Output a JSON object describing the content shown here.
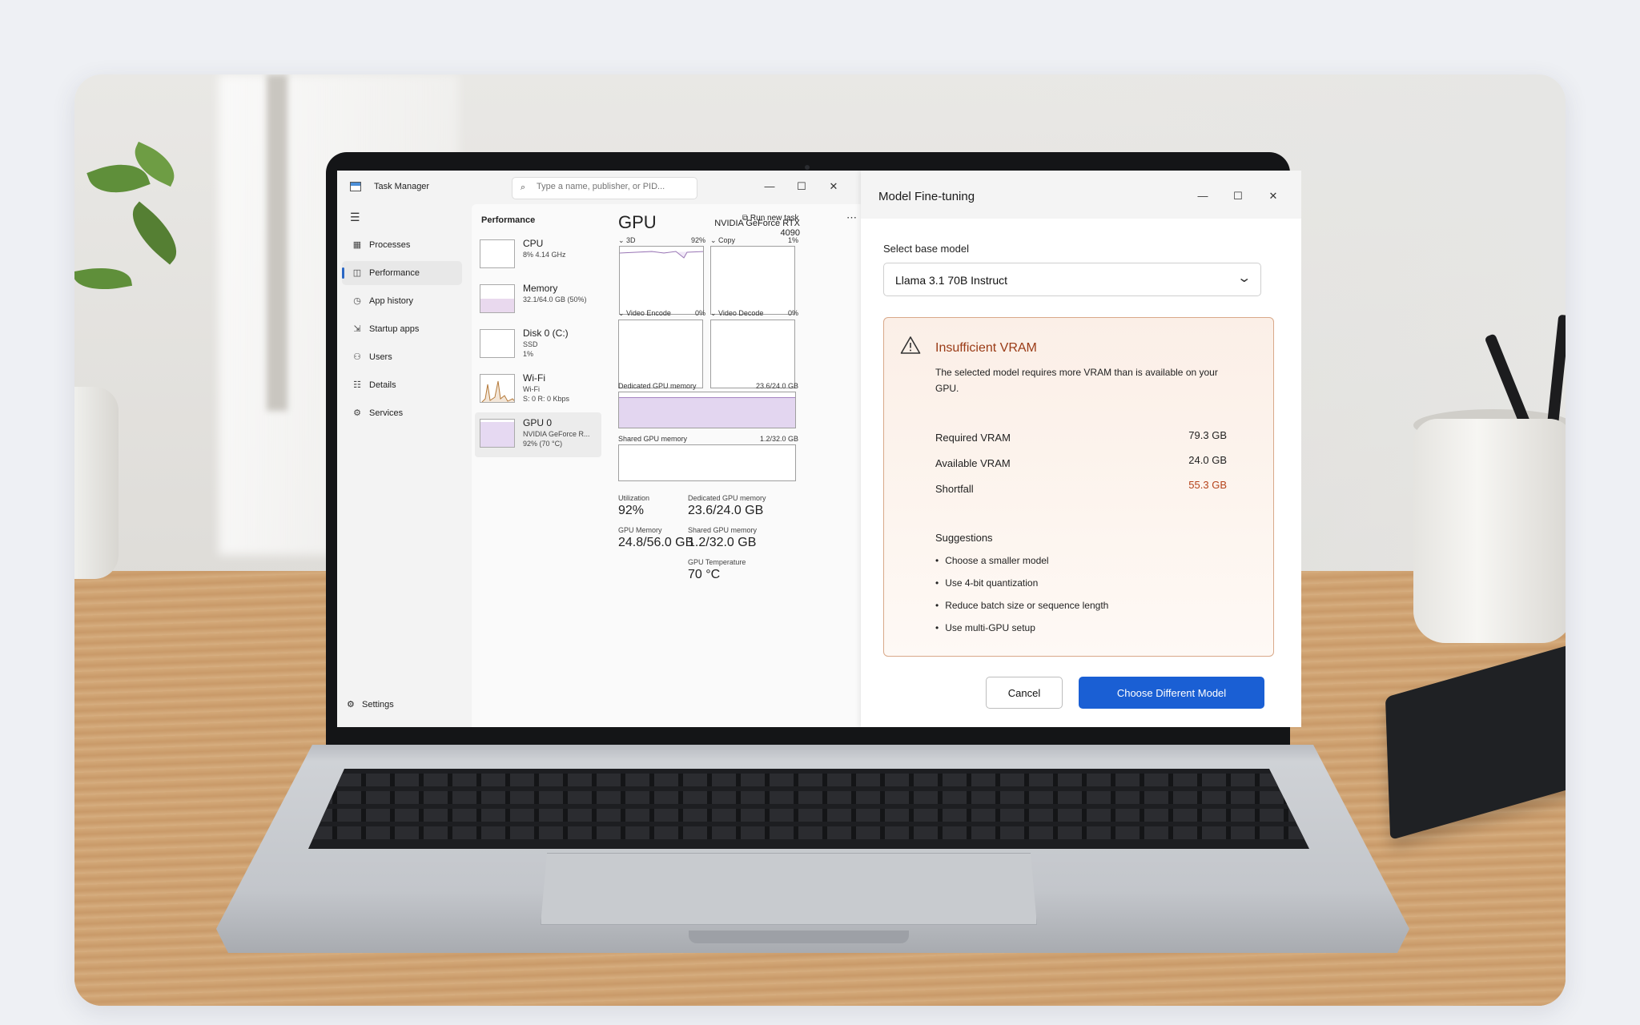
{
  "task_manager": {
    "title": "Task Manager",
    "search_placeholder": "Type a name, publisher, or PID...",
    "window_controls": {
      "minimize": "—",
      "maximize": "☐",
      "close": "✕"
    },
    "nav": [
      {
        "label": "Processes",
        "icon": "processes-icon"
      },
      {
        "label": "Performance",
        "icon": "performance-icon",
        "active": true
      },
      {
        "label": "App history",
        "icon": "history-icon"
      },
      {
        "label": "Startup apps",
        "icon": "startup-icon"
      },
      {
        "label": "Users",
        "icon": "users-icon"
      },
      {
        "label": "Details",
        "icon": "details-icon"
      },
      {
        "label": "Services",
        "icon": "services-icon"
      }
    ],
    "settings_label": "Settings",
    "performance": {
      "title": "Performance",
      "run_task": "Run new task",
      "devices": [
        {
          "name": "CPU",
          "lines": [
            "8% 4.14 GHz"
          ]
        },
        {
          "name": "Memory",
          "lines": [
            "32.1/64.0 GB (50%)"
          ]
        },
        {
          "name": "Disk 0 (C:)",
          "lines": [
            "SSD",
            "1%"
          ]
        },
        {
          "name": "Wi-Fi",
          "lines": [
            "Wi-Fi",
            "S: 0 R: 0 Kbps"
          ]
        },
        {
          "name": "GPU 0",
          "lines": [
            "NVIDIA GeForce R...",
            "92% (70 °C)"
          ],
          "active": true
        }
      ],
      "gpu": {
        "heading": "GPU",
        "model": "NVIDIA GeForce RTX 4090",
        "engines": [
          {
            "label": "3D",
            "value": "92%"
          },
          {
            "label": "Copy",
            "value": "1%"
          },
          {
            "label": "Video Encode",
            "value": "0%"
          },
          {
            "label": "Video Decode",
            "value": "0%"
          }
        ],
        "dedicated_label": "Dedicated GPU memory",
        "dedicated_value": "23.6/24.0 GB",
        "shared_label": "Shared GPU memory",
        "shared_value": "1.2/32.0 GB",
        "stats": {
          "utilization_label": "Utilization",
          "utilization": "92%",
          "dedicated_mem_label": "Dedicated GPU memory",
          "dedicated_mem": "23.6/24.0 GB",
          "gpu_memory_label": "GPU Memory",
          "gpu_memory": "24.8/56.0 GB",
          "shared_mem_label": "Shared GPU memory",
          "shared_mem": "1.2/32.0 GB",
          "temp_label": "GPU Temperature",
          "temp": "70 °C"
        }
      }
    }
  },
  "dialog": {
    "title": "Model Fine-tuning",
    "select_label": "Select base model",
    "selected_model": "Llama 3.1 70B Instruct",
    "alert": {
      "title": "Insufficient VRAM",
      "message": "The selected model requires more VRAM than is available on your GPU.",
      "rows": [
        {
          "label": "Required VRAM",
          "value": "79.3 GB"
        },
        {
          "label": "Available VRAM",
          "value": "24.0 GB"
        },
        {
          "label": "Shortfall",
          "value": "55.3 GB",
          "highlight": true
        }
      ],
      "suggestions_title": "Suggestions",
      "suggestions": [
        "Choose a smaller model",
        "Use 4-bit quantization",
        "Reduce batch size or sequence length",
        "Use multi-GPU setup"
      ]
    },
    "cancel_label": "Cancel",
    "primary_label": "Choose Different Model",
    "colors": {
      "primary": "#1a5fd4",
      "warning_text": "#9a3b16",
      "shortfall": "#b5431a",
      "alert_border": "#d9a98a"
    }
  }
}
